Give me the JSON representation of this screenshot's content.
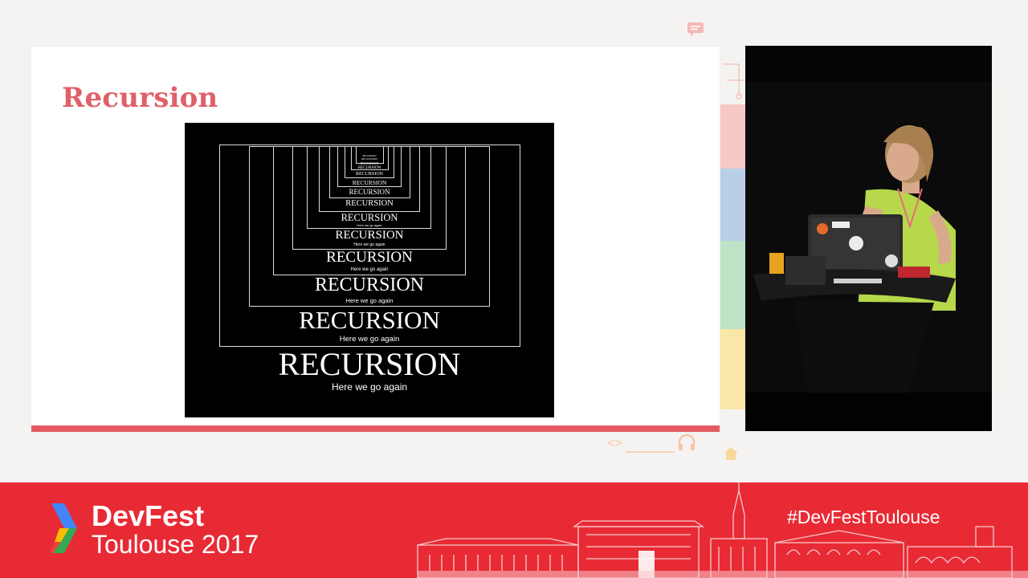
{
  "slide": {
    "title": "Recursion"
  },
  "recursion_image": {
    "word": "RECURSION",
    "tagline": "Here we go again"
  },
  "footer": {
    "event_name": "DevFest",
    "event_subtitle": "Toulouse 2017",
    "hashtag": "#DevFestToulouse"
  },
  "colors": {
    "brand_red": "#e82a35",
    "slide_accent": "#e35a63",
    "title_color": "#e0606a",
    "video_background": "#050505"
  },
  "icons": [
    "chat-bubble-icon",
    "code-brackets-icon",
    "headphones-icon",
    "home-icon",
    "devfest-logo-icon"
  ]
}
